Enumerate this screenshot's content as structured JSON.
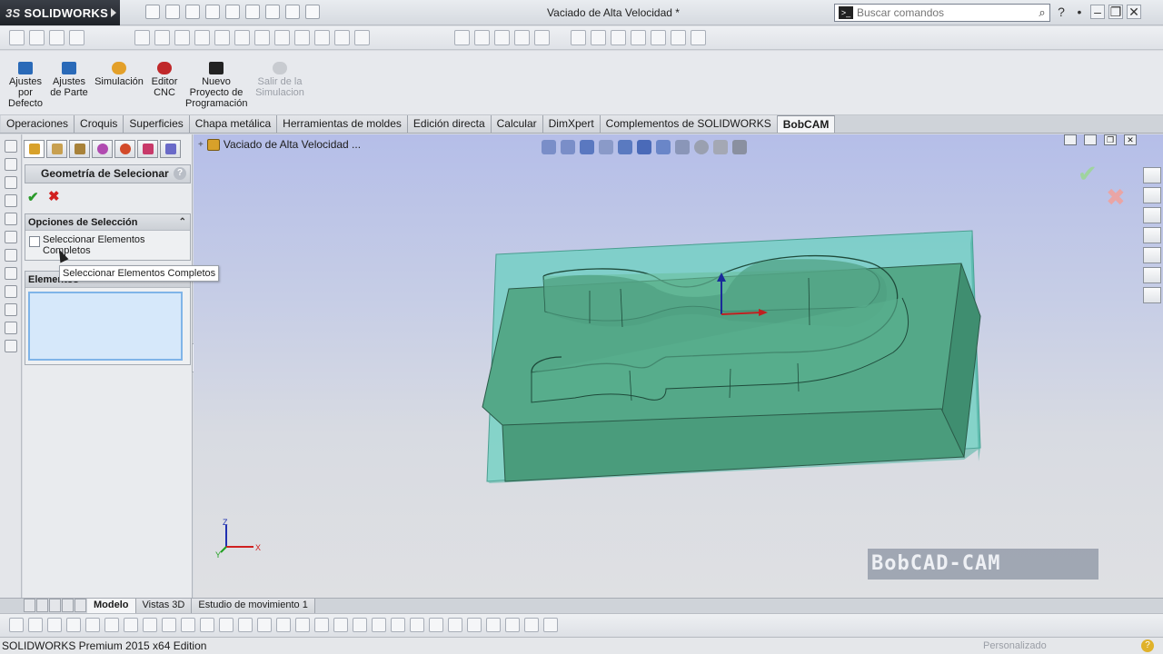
{
  "app": {
    "brand": "SOLIDWORKS",
    "document_title": "Vaciado de Alta Velocidad *",
    "search_placeholder": "Buscar comandos"
  },
  "ribbon": {
    "commands": [
      {
        "label": "Ajustes\npor\nDefecto",
        "icon": "settings-default-icon",
        "color": "#2a6ab8",
        "enabled": true
      },
      {
        "label": "Ajustes\nde Parte",
        "icon": "part-settings-icon",
        "color": "#2a6ab8",
        "enabled": true
      },
      {
        "label": "Simulación",
        "icon": "simulation-icon",
        "color": "#e3a02a",
        "enabled": true
      },
      {
        "label": "Editor\nCNC",
        "icon": "cnc-editor-icon",
        "color": "#c0282a",
        "enabled": true
      },
      {
        "label": "Nuevo\nProyecto de\nProgramación",
        "icon": "new-project-icon",
        "color": "#222222",
        "enabled": true
      },
      {
        "label": "Salir de la\nSimulacion",
        "icon": "exit-simulation-icon",
        "color": "#b0b4ba",
        "enabled": false
      }
    ]
  },
  "tabs": [
    {
      "label": "Operaciones",
      "active": false
    },
    {
      "label": "Croquis",
      "active": false
    },
    {
      "label": "Superficies",
      "active": false
    },
    {
      "label": "Chapa metálica",
      "active": false
    },
    {
      "label": "Herramientas de moldes",
      "active": false
    },
    {
      "label": "Edición directa",
      "active": false
    },
    {
      "label": "Calcular",
      "active": false
    },
    {
      "label": "DimXpert",
      "active": false
    },
    {
      "label": "Complementos de SOLIDWORKS",
      "active": false
    },
    {
      "label": "BobCAM",
      "active": true
    }
  ],
  "property_manager": {
    "title": "Geometría de Selecionar",
    "help": "?",
    "selection_options": {
      "title": "Opciones de Selección",
      "checkbox_label": "Seleccionar Elementos Completos",
      "checked": false
    },
    "elements": {
      "title": "Elementos"
    },
    "tooltip": "Seleccionar Elementos Completos"
  },
  "viewport": {
    "tree_node": "Vaciado de Alta Velocidad ...",
    "triad": {
      "x": "X",
      "y": "Y",
      "z": "Z"
    },
    "watermark": "BobCAD-CAM"
  },
  "bottom_tabs": [
    {
      "label": "Modelo",
      "active": true
    },
    {
      "label": "Vistas 3D",
      "active": false
    },
    {
      "label": "Estudio de movimiento 1",
      "active": false
    }
  ],
  "status": {
    "edition": "SOLIDWORKS Premium 2015 x64 Edition",
    "customization": "Personalizado"
  },
  "colors": {
    "part_fill": "#4fa585",
    "stock_fill": "#6ed2c4",
    "accent_ok": "#2a9a2a",
    "accent_cancel": "#d12020"
  }
}
